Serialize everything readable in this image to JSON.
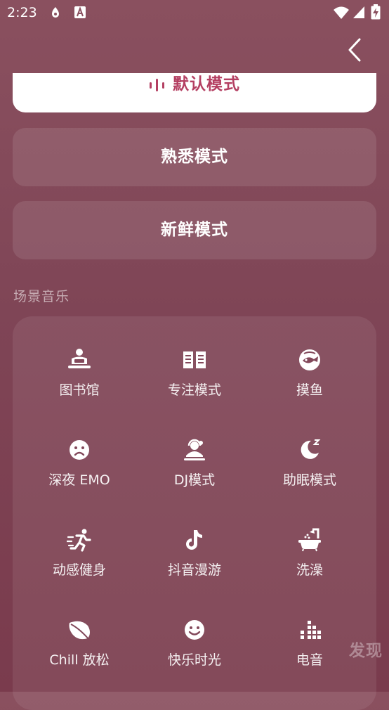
{
  "status_bar": {
    "time": "2:23",
    "icons": [
      "app-notification-icon",
      "keyboard-a-icon",
      "wifi-icon",
      "signal-icon",
      "battery-charging-icon"
    ]
  },
  "header": {
    "back_icon": "chevron-left-icon"
  },
  "modes": {
    "default_label": "默认模式",
    "familiar_label": "熟悉模式",
    "fresh_label": "新鲜模式",
    "accent_color": "#b43f62"
  },
  "scenes": {
    "title": "场景音乐",
    "items": [
      {
        "label": "图书馆",
        "icon": "library-reader-icon"
      },
      {
        "label": "专注模式",
        "icon": "open-book-icon"
      },
      {
        "label": "摸鱼",
        "icon": "fish-face-icon"
      },
      {
        "label": "深夜 EMO",
        "icon": "sad-face-icon"
      },
      {
        "label": "DJ模式",
        "icon": "dj-headphones-icon"
      },
      {
        "label": "助眠模式",
        "icon": "sleep-moon-icon"
      },
      {
        "label": "动感健身",
        "icon": "running-person-icon"
      },
      {
        "label": "抖音漫游",
        "icon": "tiktok-note-icon"
      },
      {
        "label": "洗澡",
        "icon": "bathtub-icon"
      },
      {
        "label": "Chill 放松",
        "icon": "leaf-icon"
      },
      {
        "label": "快乐时光",
        "icon": "happy-face-icon"
      },
      {
        "label": "电音",
        "icon": "equalizer-icon"
      }
    ]
  },
  "floating": {
    "discover_label": "发现"
  }
}
